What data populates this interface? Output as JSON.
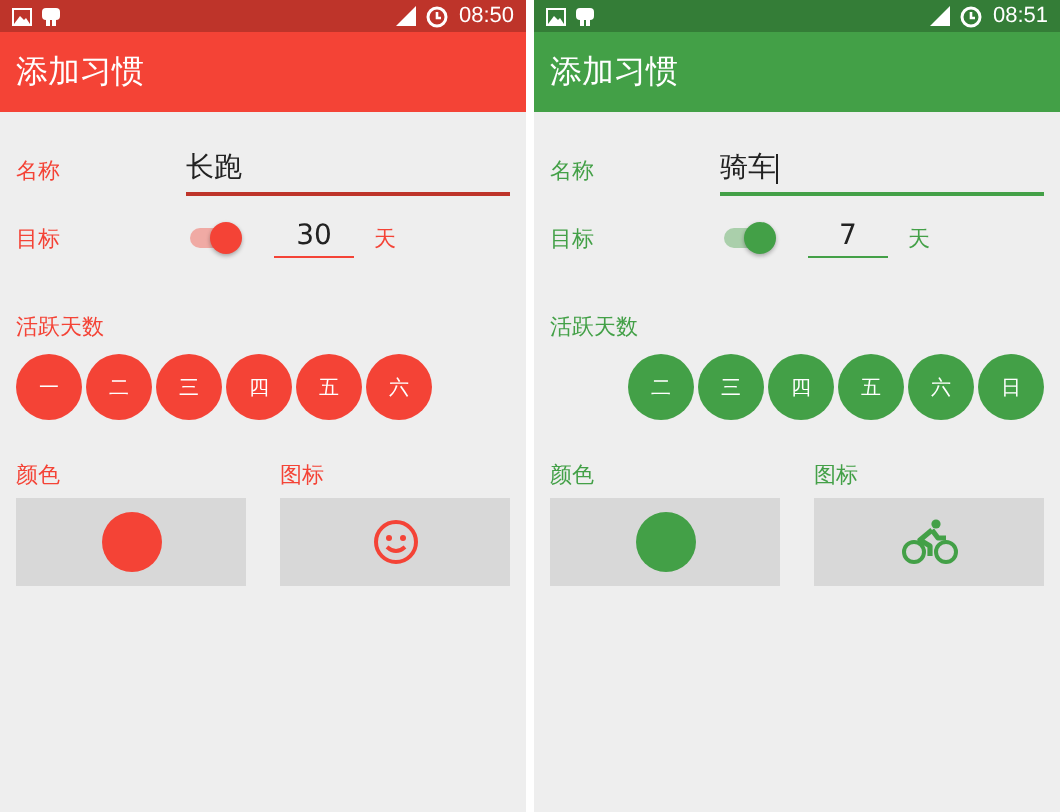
{
  "screens": [
    {
      "color": "#f44336",
      "status_bar": {
        "time": "08:50"
      },
      "title": "添加习惯",
      "name": {
        "label": "名称",
        "value": "长跑",
        "focused": false
      },
      "goal": {
        "label": "目标",
        "on": true,
        "value": "30",
        "unit": "天"
      },
      "days": {
        "label": "活跃天数",
        "kind": "start",
        "items": [
          {
            "label": "一",
            "selected": true
          },
          {
            "label": "二",
            "selected": true
          },
          {
            "label": "三",
            "selected": true
          },
          {
            "label": "四",
            "selected": true
          },
          {
            "label": "五",
            "selected": true
          },
          {
            "label": "六",
            "selected": true
          }
        ]
      },
      "color_picker": {
        "label": "颜色"
      },
      "icon": {
        "label": "图标",
        "kind": "smiley"
      }
    },
    {
      "color": "#43a047",
      "status_bar": {
        "time": "08:51"
      },
      "title": "添加习惯",
      "name": {
        "label": "名称",
        "value": "骑车",
        "focused": true
      },
      "goal": {
        "label": "目标",
        "on": true,
        "value": "7",
        "unit": "天"
      },
      "days": {
        "label": "活跃天数",
        "kind": "end",
        "items": [
          {
            "label": "二",
            "selected": true
          },
          {
            "label": "三",
            "selected": true
          },
          {
            "label": "四",
            "selected": true
          },
          {
            "label": "五",
            "selected": true
          },
          {
            "label": "六",
            "selected": true
          },
          {
            "label": "日",
            "selected": true
          }
        ]
      },
      "color_picker": {
        "label": "颜色"
      },
      "icon": {
        "label": "图标",
        "kind": "bike"
      }
    }
  ]
}
